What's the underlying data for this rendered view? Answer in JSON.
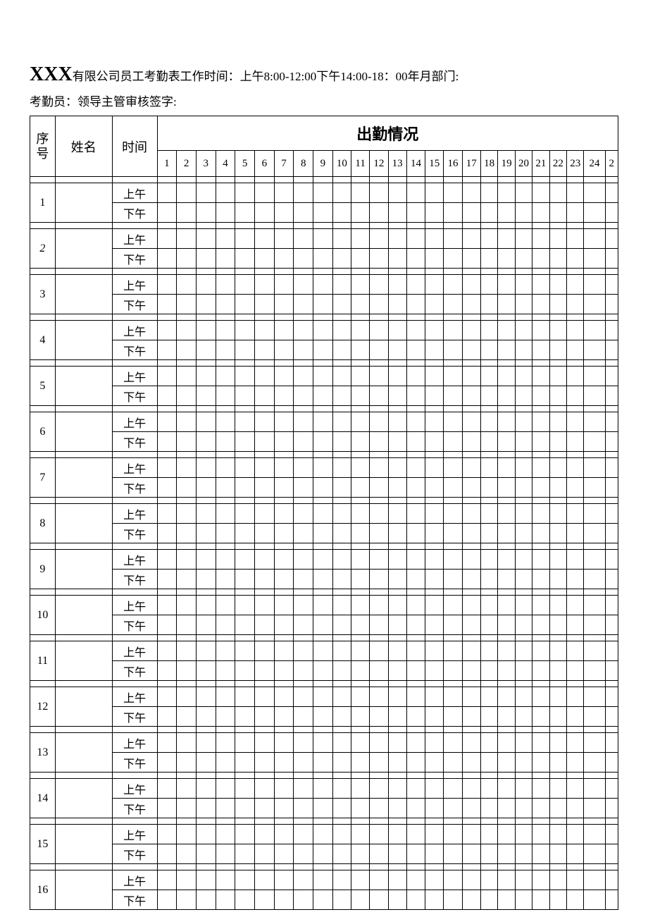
{
  "header": {
    "company_prefix": "XXX",
    "title_rest": "有限公司员工考勤表工作时间：上午8:00-12:00下午14:00-18：00年月部门:",
    "line2": "考勤员：领导主管审核签字:"
  },
  "table": {
    "col_seq": "序号",
    "col_name": "姓名",
    "col_time": "时间",
    "col_attendance": "出勤情况",
    "days": [
      "1",
      "2",
      "3",
      "4",
      "5",
      "6",
      "7",
      "8",
      "9",
      "10",
      "11",
      "12",
      "13",
      "14",
      "15",
      "16",
      "17",
      "18",
      "19",
      "20",
      "21",
      "22",
      "23",
      "24",
      "2"
    ],
    "am_label": "上午",
    "pm_label": "下午",
    "rows": [
      {
        "seq": "1",
        "italic": false
      },
      {
        "seq": "2",
        "italic": true
      },
      {
        "seq": "3",
        "italic": false
      },
      {
        "seq": "4",
        "italic": false
      },
      {
        "seq": "5",
        "italic": false
      },
      {
        "seq": "6",
        "italic": false
      },
      {
        "seq": "7",
        "italic": false
      },
      {
        "seq": "8",
        "italic": false
      },
      {
        "seq": "9",
        "italic": false
      },
      {
        "seq": "10",
        "italic": false
      },
      {
        "seq": "11",
        "italic": false
      },
      {
        "seq": "12",
        "italic": false
      },
      {
        "seq": "13",
        "italic": false
      },
      {
        "seq": "14",
        "italic": false
      },
      {
        "seq": "15",
        "italic": false
      },
      {
        "seq": "16",
        "italic": false
      }
    ]
  }
}
